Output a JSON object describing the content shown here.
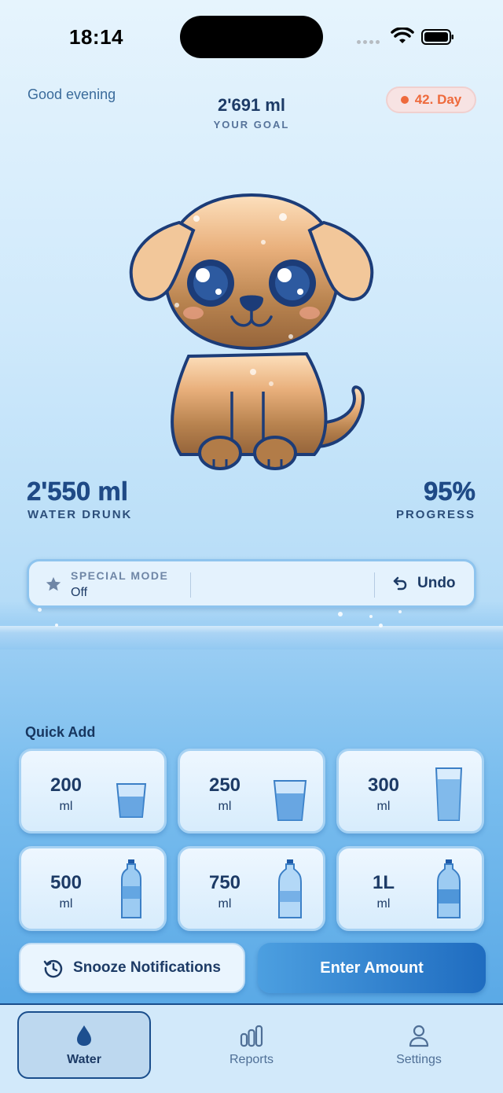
{
  "status_bar": {
    "time": "18:14"
  },
  "header": {
    "greeting": "Good evening",
    "goal_value": "2'691 ml",
    "goal_label": "YOUR GOAL",
    "day_badge": "42. Day"
  },
  "stats": {
    "drunk_value": "2'550 ml",
    "drunk_label": "WATER DRUNK",
    "progress_value": "95%",
    "progress_label": "PROGRESS",
    "progress_fraction": 0.95
  },
  "special_mode": {
    "label": "SPECIAL MODE",
    "value": "Off",
    "undo_label": "Undo"
  },
  "quick_add": {
    "title": "Quick Add",
    "items": [
      {
        "amount": "200",
        "unit": "ml",
        "icon": "small-glass-icon"
      },
      {
        "amount": "250",
        "unit": "ml",
        "icon": "glass-icon"
      },
      {
        "amount": "300",
        "unit": "ml",
        "icon": "tall-glass-icon"
      },
      {
        "amount": "500",
        "unit": "ml",
        "icon": "small-bottle-icon"
      },
      {
        "amount": "750",
        "unit": "ml",
        "icon": "bottle-icon"
      },
      {
        "amount": "1L",
        "unit": "ml",
        "icon": "large-bottle-icon"
      }
    ]
  },
  "actions": {
    "snooze_label": "Snooze Notifications",
    "enter_label": "Enter Amount"
  },
  "tabs": [
    {
      "label": "Water",
      "icon": "water-drop-icon",
      "active": true
    },
    {
      "label": "Reports",
      "icon": "bar-chart-icon",
      "active": false
    },
    {
      "label": "Settings",
      "icon": "person-icon",
      "active": false
    }
  ],
  "colors": {
    "accent": "#1f6cc0",
    "badge": "#ee6a3c",
    "text_dark": "#1d3b66"
  }
}
